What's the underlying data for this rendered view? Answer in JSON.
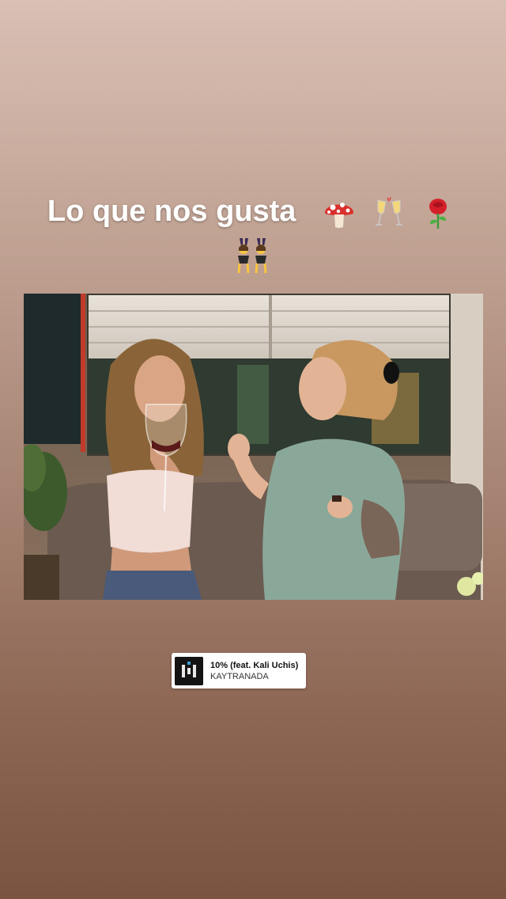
{
  "story": {
    "caption": {
      "text": "Lo que nos gusta",
      "emojis": [
        "mushroom-icon",
        "clinking-glasses-icon",
        "rose-icon",
        "women-with-bunny-ears-icon"
      ]
    },
    "music_sticker": {
      "song_title": "10% (feat. Kali Uchis)",
      "artist": "KAYTRANADA",
      "album_art_icon": "album-art-icon"
    }
  },
  "colors": {
    "background_top": "#d9c0b4",
    "background_bottom": "#7a5440",
    "caption_text": "#ffffff",
    "sticker_bg": "#ffffff"
  }
}
